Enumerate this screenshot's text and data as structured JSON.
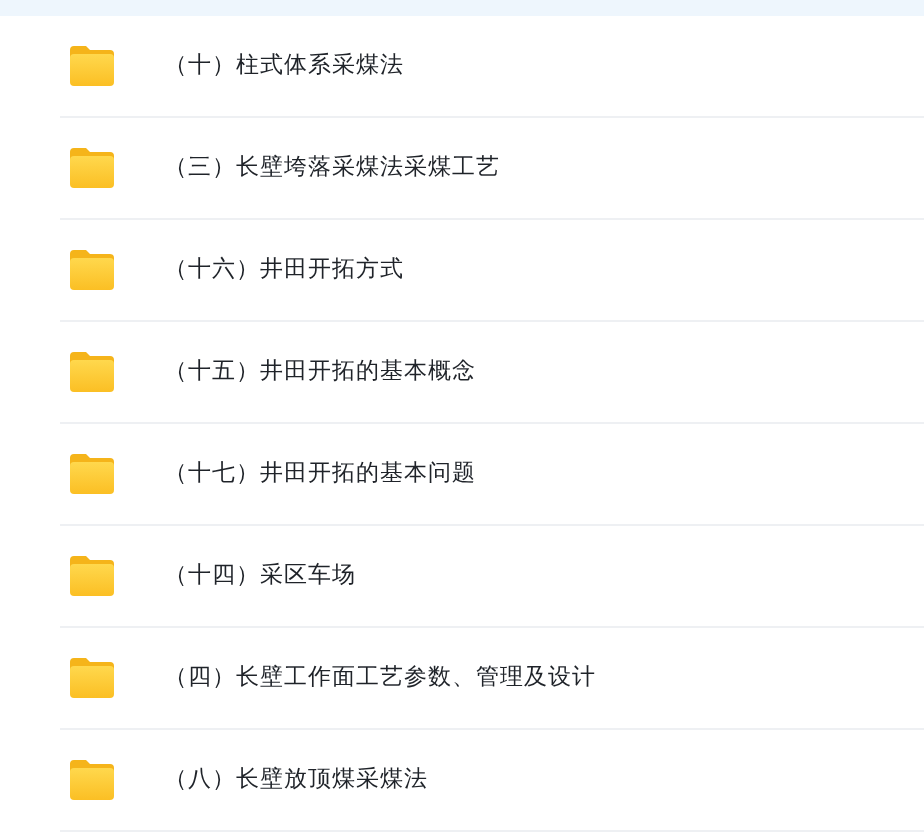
{
  "folders": [
    {
      "name": "（十）柱式体系采煤法"
    },
    {
      "name": "（三）长壁垮落采煤法采煤工艺"
    },
    {
      "name": "（十六）井田开拓方式"
    },
    {
      "name": "（十五）井田开拓的基本概念"
    },
    {
      "name": "（十七）井田开拓的基本问题"
    },
    {
      "name": "（十四）采区车场"
    },
    {
      "name": "（四）长壁工作面工艺参数、管理及设计"
    },
    {
      "name": "（八）长壁放顶煤采煤法"
    }
  ]
}
